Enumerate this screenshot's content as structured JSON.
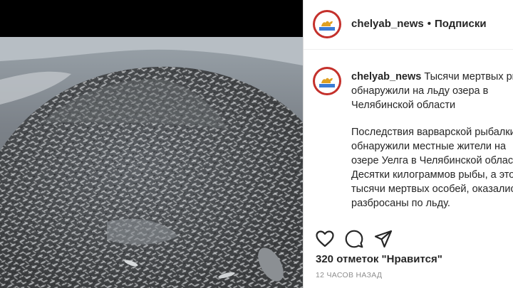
{
  "post": {
    "username": "chelyab_news",
    "separator": "•",
    "follow_label": "Подписки",
    "caption_lines_1": [
      "Тысячи мертвых рыб",
      "обнаружили на льду озера в",
      "Челябинской области"
    ],
    "caption_lines_2": [
      "Последствия варварской рыбалки",
      "обнаружили местные жители на",
      "озере Уелга в Челябинской области.",
      "Десятки килограммов рыбы, а это",
      "тысячи мертвых особей, оказались",
      "разбросаны по льду."
    ],
    "likes": "320 отметок \"Нравится\"",
    "timestamp": "12 ЧАСОВ НАЗАД"
  },
  "icons": {
    "like": "heart-icon",
    "comment": "comment-icon",
    "share": "paper-plane-icon"
  },
  "colors": {
    "avatar_ring": "#c4302b",
    "text": "#262626",
    "muted": "#8e8e8e",
    "border": "#dbdbdb"
  }
}
